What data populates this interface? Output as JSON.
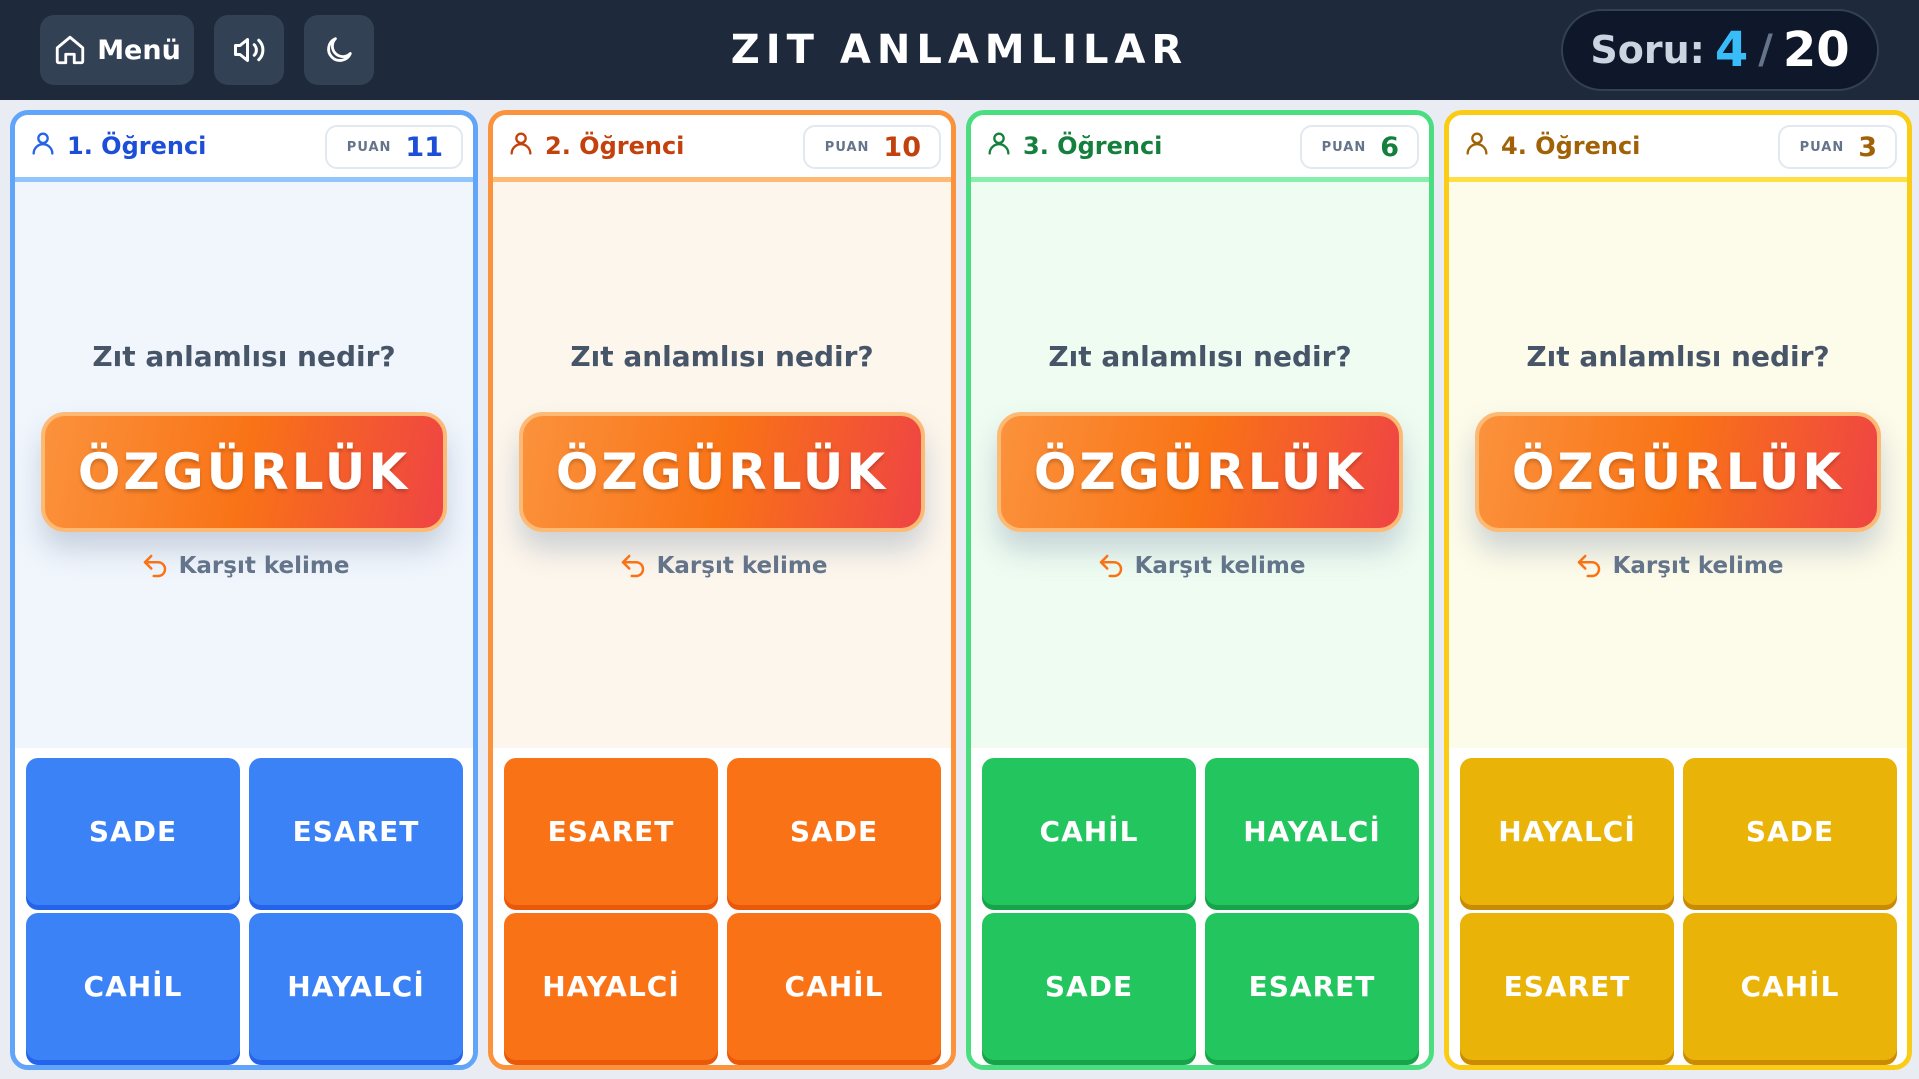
{
  "header": {
    "menu_label": "Menü",
    "title": "ZIT ANLAMLILAR",
    "counter_label": "Soru:",
    "counter_current": "4",
    "counter_separator": "/",
    "counter_total": "20"
  },
  "icons": {
    "menu": "home-icon",
    "sound": "speaker-icon",
    "theme": "moon-icon",
    "player": "user-icon",
    "hint": "reply-arrow-icon"
  },
  "colors": {
    "player1": "#3b82f6",
    "player2": "#f97316",
    "player3": "#22c55e",
    "player4": "#eab308",
    "word_gradient": [
      "#fb923c",
      "#ef4444"
    ],
    "counter_current": "#38bdf8"
  },
  "players": [
    {
      "name": "1. Öğrenci",
      "score_label": "PUAN",
      "score": "11",
      "question": "Zıt anlamlısı nedir?",
      "word": "ÖZGÜRLÜK",
      "hint": "Karşıt kelime",
      "answers": [
        "SADE",
        "ESARET",
        "CAHİL",
        "HAYALCİ"
      ]
    },
    {
      "name": "2. Öğrenci",
      "score_label": "PUAN",
      "score": "10",
      "question": "Zıt anlamlısı nedir?",
      "word": "ÖZGÜRLÜK",
      "hint": "Karşıt kelime",
      "answers": [
        "ESARET",
        "SADE",
        "HAYALCİ",
        "CAHİL"
      ]
    },
    {
      "name": "3. Öğrenci",
      "score_label": "PUAN",
      "score": "6",
      "question": "Zıt anlamlısı nedir?",
      "word": "ÖZGÜRLÜK",
      "hint": "Karşıt kelime",
      "answers": [
        "CAHİL",
        "HAYALCİ",
        "SADE",
        "ESARET"
      ]
    },
    {
      "name": "4. Öğrenci",
      "score_label": "PUAN",
      "score": "3",
      "question": "Zıt anlamlısı nedir?",
      "word": "ÖZGÜRLÜK",
      "hint": "Karşıt kelime",
      "answers": [
        "HAYALCİ",
        "SADE",
        "ESARET",
        "CAHİL"
      ]
    }
  ]
}
